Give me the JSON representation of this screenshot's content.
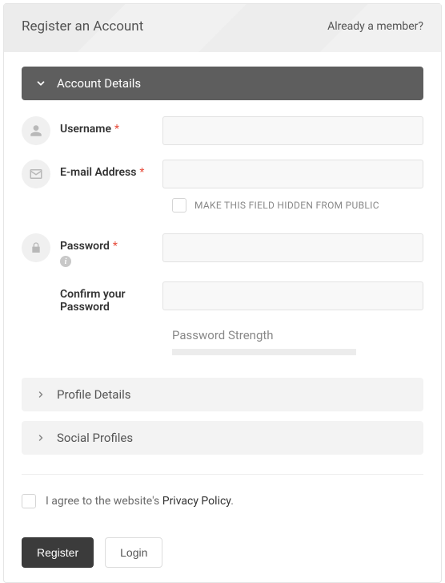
{
  "header": {
    "title": "Register an Account",
    "member_link": "Already a member?"
  },
  "sections": {
    "account": "Account Details",
    "profile": "Profile Details",
    "social": "Social Profiles"
  },
  "fields": {
    "username_label": "Username",
    "email_label": "E-mail Address",
    "hidden_hint": "MAKE THIS FIELD HIDDEN FROM PUBLIC",
    "password_label": "Password",
    "confirm_label": "Confirm your Password",
    "strength_label": "Password Strength"
  },
  "agree": {
    "prefix": "I agree to the website's ",
    "policy": "Privacy Policy",
    "suffix": "."
  },
  "buttons": {
    "register": "Register",
    "login": "Login"
  }
}
